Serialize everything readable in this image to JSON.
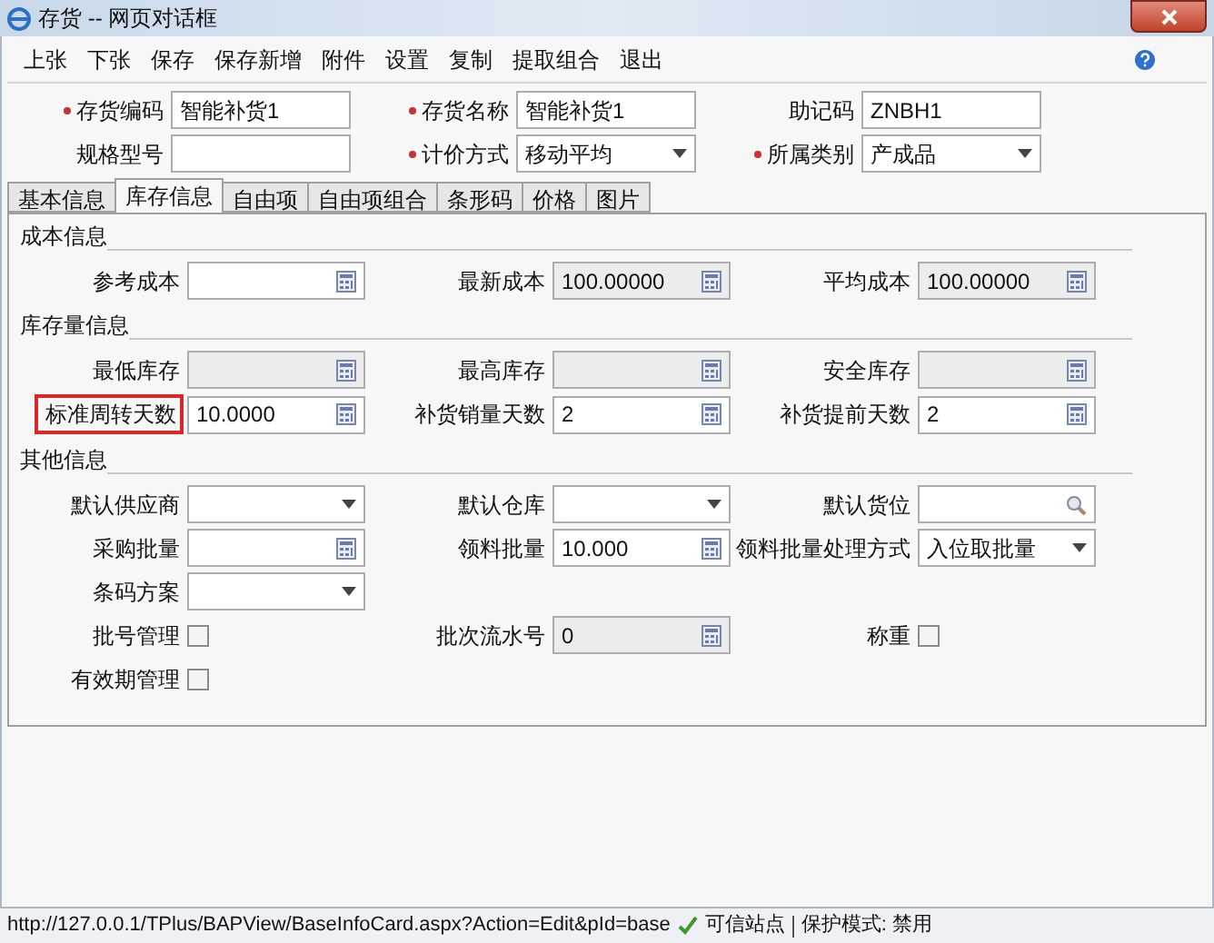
{
  "window": {
    "title": "存货 -- 网页对话框"
  },
  "toolbar": [
    "上张",
    "下张",
    "保存",
    "保存新增",
    "附件",
    "设置",
    "复制",
    "提取组合",
    "退出"
  ],
  "header_rows": [
    [
      {
        "label": "存货编码",
        "required": true,
        "kind": "text",
        "value": "智能补货1"
      },
      {
        "label": "存货名称",
        "required": true,
        "kind": "text",
        "value": "智能补货1"
      },
      {
        "label": "助记码",
        "required": false,
        "kind": "text",
        "value": "ZNBH1"
      }
    ],
    [
      {
        "label": "规格型号",
        "required": false,
        "kind": "text"
      },
      {
        "label": "计价方式",
        "required": true,
        "kind": "select",
        "value": "移动平均"
      },
      {
        "label": "所属类别",
        "required": true,
        "kind": "select",
        "value": "产成品"
      }
    ]
  ],
  "tabs": [
    {
      "label": "基本信息",
      "selected": false
    },
    {
      "label": "库存信息",
      "selected": true
    },
    {
      "label": "自由项",
      "selected": false
    },
    {
      "label": "自由项组合",
      "selected": false
    },
    {
      "label": "条形码",
      "selected": false
    },
    {
      "label": "价格",
      "selected": false
    },
    {
      "label": "图片",
      "selected": false
    }
  ],
  "sections": [
    {
      "title": "成本信息",
      "rows": [
        [
          {
            "label": "参考成本",
            "kind": "calc",
            "disabled": false
          },
          {
            "label": "最新成本",
            "kind": "calc",
            "disabled": true,
            "value": "100.00000"
          },
          {
            "label": "平均成本",
            "kind": "calc",
            "disabled": true,
            "value": "100.00000"
          }
        ]
      ]
    },
    {
      "title": "库存量信息",
      "rows": [
        [
          {
            "label": "最低库存",
            "kind": "calc",
            "disabled": true
          },
          {
            "label": "最高库存",
            "kind": "calc",
            "disabled": true
          },
          {
            "label": "安全库存",
            "kind": "calc",
            "disabled": true
          }
        ],
        [
          {
            "label": "标准周转天数",
            "kind": "calc",
            "disabled": false,
            "value": "10.0000",
            "highlighted": true
          },
          {
            "label": "补货销量天数",
            "kind": "calc",
            "disabled": false,
            "value": "2"
          },
          {
            "label": "补货提前天数",
            "kind": "calc",
            "disabled": false,
            "value": "2"
          }
        ]
      ]
    },
    {
      "title": "其他信息",
      "rows": [
        [
          {
            "label": "默认供应商",
            "kind": "select",
            "disabled": false
          },
          {
            "label": "默认仓库",
            "kind": "select",
            "disabled": false
          },
          {
            "label": "默认货位",
            "kind": "lookup",
            "disabled": false
          }
        ],
        [
          {
            "label": "采购批量",
            "kind": "calc",
            "disabled": false
          },
          {
            "label": "领料批量",
            "kind": "calc",
            "disabled": false,
            "value": "10.000"
          },
          {
            "label": "领料批量处理方式",
            "kind": "select",
            "disabled": false,
            "value": "入位取批量"
          }
        ],
        [
          {
            "label": "条码方案",
            "kind": "select",
            "disabled": false
          }
        ],
        [
          {
            "label": "批号管理",
            "kind": "checkbox",
            "checked": false
          },
          {
            "label": "批次流水号",
            "kind": "calc",
            "disabled": true,
            "value": "0"
          },
          {
            "label": "称重",
            "kind": "checkbox",
            "checked": false
          }
        ],
        [
          {
            "label": "有效期管理",
            "kind": "checkbox",
            "checked": false
          }
        ]
      ]
    }
  ],
  "status_bar": {
    "url": "http://127.0.0.1/TPlus/BAPView/BaseInfoCard.aspx?Action=Edit&pId=base",
    "zone": "可信站点",
    "protected_mode": "保护模式: 禁用"
  }
}
